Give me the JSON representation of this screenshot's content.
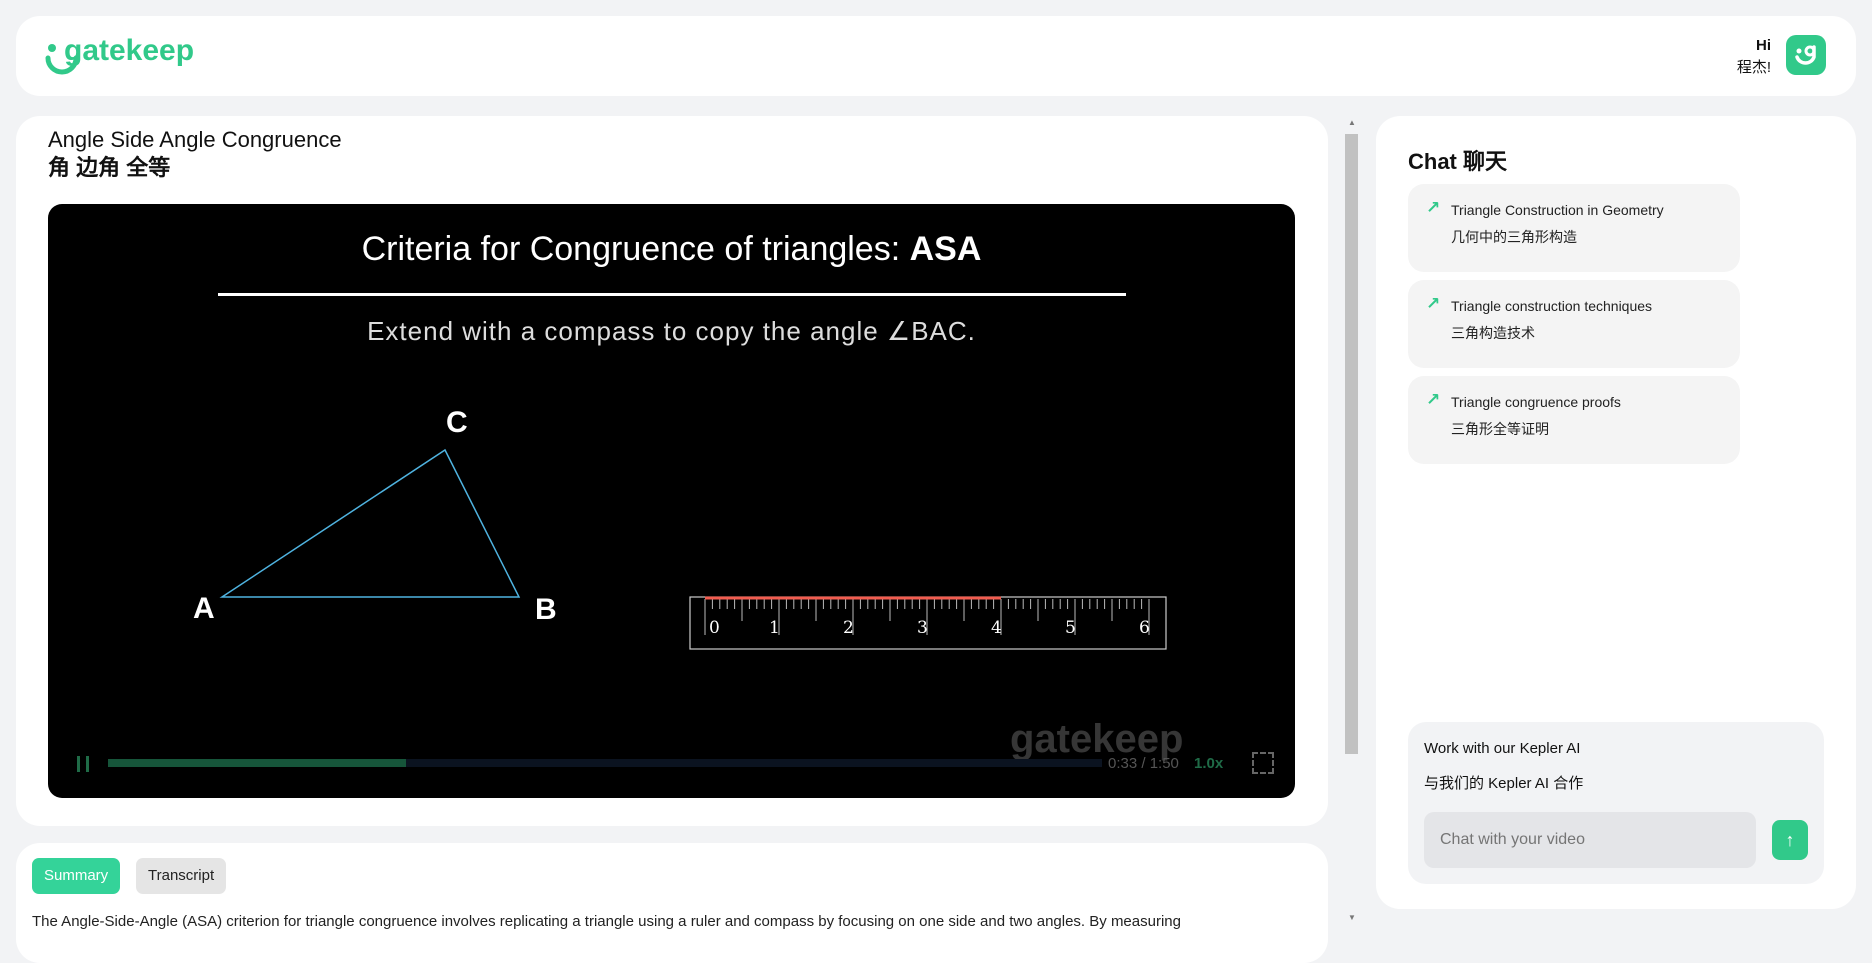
{
  "header": {
    "logo": "gatekeep",
    "greeting": "Hi",
    "user": "程杰!"
  },
  "video": {
    "title_en": "Angle Side Angle Congruence",
    "title_zh": "角 边角 全等",
    "slide_title": "Criteria for Congruence of triangles:",
    "slide_title_bold": "ASA",
    "subtitle": "Extend with a compass to copy the angle ∠BAC.",
    "vertices": {
      "a": "A",
      "b": "B",
      "c": "C"
    },
    "ruler_labels": [
      "0",
      "1",
      "2",
      "3",
      "4",
      "5",
      "6"
    ],
    "ruler_highlight": 4,
    "watermark": "gatekeep",
    "time": "0:33 / 1:50",
    "progress": 0.3,
    "speed": "1.0x",
    "colors": {
      "accent": "#31c98a",
      "triangle": "#4fb3e0",
      "ruler_highlight": "#f25c4f"
    }
  },
  "bottom": {
    "tabs": [
      "Summary",
      "Transcript"
    ],
    "active": "Summary",
    "summary": "The Angle-Side-Angle (ASA) criterion for triangle congruence involves replicating a triangle using a ruler and compass by focusing on one side and two angles. By measuring"
  },
  "chat": {
    "title": "Chat 聊天",
    "suggestions": [
      {
        "en": "Triangle Construction in Geometry",
        "zh": "几何中的三角形构造"
      },
      {
        "en": "Triangle construction techniques",
        "zh": "三角构造技术"
      },
      {
        "en": "Triangle congruence proofs",
        "zh": "三角形全等证明"
      }
    ],
    "kepler_en": "Work with our Kepler AI",
    "kepler_zh": "与我们的 Kepler AI 合作",
    "input_placeholder": "Chat with your video"
  }
}
